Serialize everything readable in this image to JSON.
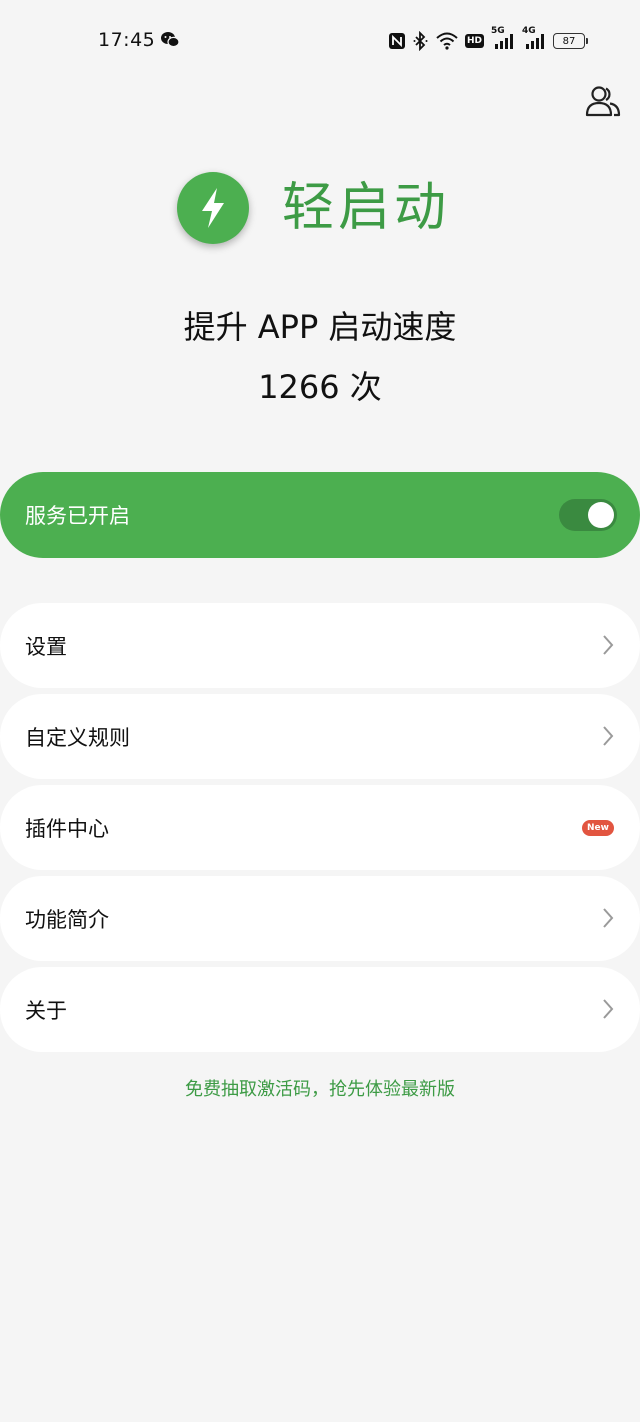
{
  "status_bar": {
    "time": "17:45",
    "left_icons": [
      "wechat-icon"
    ],
    "right_icons": [
      "nfc-icon",
      "bluetooth-icon",
      "wifi-icon",
      "hd-icon",
      "signal-5g-icon",
      "signal-4g-icon",
      "battery-icon"
    ],
    "hd_label": "HD",
    "net1": "5G",
    "net2": "4G",
    "battery_level": "87"
  },
  "header": {
    "account_icon": "people-icon"
  },
  "brand": {
    "logo_icon": "lightning-icon",
    "app_name": "轻启动"
  },
  "hero": {
    "tagline": "提升 APP 启动速度",
    "count": "1266 次"
  },
  "service": {
    "label": "服务已开启",
    "enabled": true
  },
  "menu": {
    "items": [
      {
        "label": "设置",
        "trailing": "chevron-right-icon"
      },
      {
        "label": "自定义规则",
        "trailing": "chevron-right-icon"
      },
      {
        "label": "插件中心",
        "trailing": "new-badge",
        "badge": "New"
      },
      {
        "label": "功能简介",
        "trailing": "chevron-right-icon"
      },
      {
        "label": "关于",
        "trailing": "chevron-right-icon"
      }
    ]
  },
  "promo": {
    "text": "免费抽取激活码，抢先体验最新版"
  },
  "colors": {
    "primary_green": "#4caf50",
    "brand_text_green": "#3d9b45",
    "badge_red": "#e25540",
    "background": "#f5f5f5"
  }
}
